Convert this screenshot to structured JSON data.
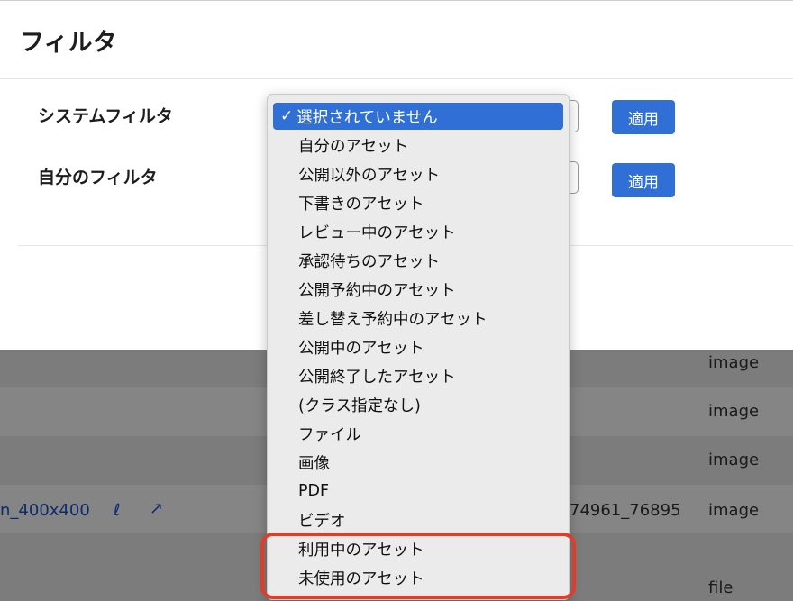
{
  "modal": {
    "title": "フィルタ",
    "system_filter_label": "システムフィルタ",
    "my_filter_label": "自分のフィルタ",
    "apply_label_1": "適用",
    "apply_label_2": "適用"
  },
  "dropdown": {
    "selected": "選択されていません",
    "check": "✓",
    "items": [
      "自分のアセット",
      "公開以外のアセット",
      "下書きのアセット",
      "レビュー中のアセット",
      "承認待ちのアセット",
      "公開予約中のアセット",
      "差し替え予約中のアセット",
      "公開中のアセット",
      "公開終了したアセット",
      "(クラス指定なし)",
      "ファイル",
      "画像",
      "PDF",
      "ビデオ",
      "利用中のアセット",
      "未使用のアセット"
    ]
  },
  "background_table": {
    "rows": [
      {
        "type": "image"
      },
      {
        "type": "image"
      },
      {
        "type": "image"
      },
      {
        "name": "n_400x400",
        "id": "74961_76895",
        "type": "image"
      },
      {
        "type": "file"
      }
    ]
  }
}
